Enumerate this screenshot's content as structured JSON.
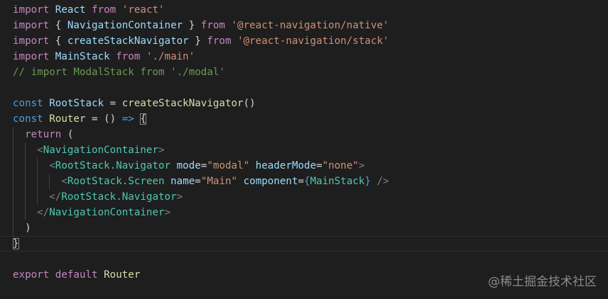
{
  "editor": {
    "lines": [
      {
        "indent": 0,
        "guides": [],
        "tokens": [
          {
            "c": "kw",
            "t": "import"
          },
          {
            "c": "pun",
            "t": " "
          },
          {
            "c": "var",
            "t": "React"
          },
          {
            "c": "pun",
            "t": " "
          },
          {
            "c": "kw",
            "t": "from"
          },
          {
            "c": "pun",
            "t": " "
          },
          {
            "c": "str",
            "t": "'react'"
          }
        ]
      },
      {
        "indent": 0,
        "guides": [],
        "tokens": [
          {
            "c": "kw",
            "t": "import"
          },
          {
            "c": "pun",
            "t": " { "
          },
          {
            "c": "var",
            "t": "NavigationContainer"
          },
          {
            "c": "pun",
            "t": " } "
          },
          {
            "c": "kw",
            "t": "from"
          },
          {
            "c": "pun",
            "t": " "
          },
          {
            "c": "str",
            "t": "'@react-navigation/native'"
          }
        ]
      },
      {
        "indent": 0,
        "guides": [],
        "tokens": [
          {
            "c": "kw",
            "t": "import"
          },
          {
            "c": "pun",
            "t": " { "
          },
          {
            "c": "var",
            "t": "createStackNavigator"
          },
          {
            "c": "pun",
            "t": " } "
          },
          {
            "c": "kw",
            "t": "from"
          },
          {
            "c": "pun",
            "t": " "
          },
          {
            "c": "str",
            "t": "'@react-navigation/stack'"
          }
        ]
      },
      {
        "indent": 0,
        "guides": [],
        "tokens": [
          {
            "c": "kw",
            "t": "import"
          },
          {
            "c": "pun",
            "t": " "
          },
          {
            "c": "var",
            "t": "MainStack"
          },
          {
            "c": "pun",
            "t": " "
          },
          {
            "c": "kw",
            "t": "from"
          },
          {
            "c": "pun",
            "t": " "
          },
          {
            "c": "str",
            "t": "'./main'"
          }
        ]
      },
      {
        "indent": 0,
        "guides": [],
        "tokens": [
          {
            "c": "com",
            "t": "// import ModalStack from './modal'"
          }
        ]
      },
      {
        "indent": 0,
        "guides": [],
        "tokens": []
      },
      {
        "indent": 0,
        "guides": [],
        "tokens": [
          {
            "c": "kw2",
            "t": "const"
          },
          {
            "c": "pun",
            "t": " "
          },
          {
            "c": "var",
            "t": "RootStack"
          },
          {
            "c": "pun",
            "t": " = "
          },
          {
            "c": "fn",
            "t": "createStackNavigator"
          },
          {
            "c": "pun",
            "t": "()"
          }
        ]
      },
      {
        "indent": 0,
        "guides": [],
        "tokens": [
          {
            "c": "kw2",
            "t": "const"
          },
          {
            "c": "pun",
            "t": " "
          },
          {
            "c": "fn",
            "t": "Router"
          },
          {
            "c": "pun",
            "t": " = () "
          },
          {
            "c": "kw2",
            "t": "=>"
          },
          {
            "c": "pun",
            "t": " "
          },
          {
            "c": "bracket-match",
            "t": "{"
          }
        ]
      },
      {
        "indent": 1,
        "guides": [
          0
        ],
        "tokens": [
          {
            "c": "kw",
            "t": "return"
          },
          {
            "c": "pun",
            "t": " ("
          }
        ]
      },
      {
        "indent": 2,
        "guides": [
          0,
          1
        ],
        "tokens": [
          {
            "c": "tag",
            "t": "<"
          },
          {
            "c": "comp",
            "t": "NavigationContainer"
          },
          {
            "c": "tag",
            "t": ">"
          }
        ]
      },
      {
        "indent": 3,
        "guides": [
          0,
          1,
          2
        ],
        "tokens": [
          {
            "c": "tag",
            "t": "<"
          },
          {
            "c": "comp",
            "t": "RootStack.Navigator"
          },
          {
            "c": "pun",
            "t": " "
          },
          {
            "c": "attr",
            "t": "mode"
          },
          {
            "c": "pun",
            "t": "="
          },
          {
            "c": "str",
            "t": "\"modal\""
          },
          {
            "c": "pun",
            "t": " "
          },
          {
            "c": "attr",
            "t": "headerMode"
          },
          {
            "c": "pun",
            "t": "="
          },
          {
            "c": "str",
            "t": "\"none\""
          },
          {
            "c": "tag",
            "t": ">"
          }
        ]
      },
      {
        "indent": 4,
        "guides": [
          0,
          1,
          2,
          3
        ],
        "tokens": [
          {
            "c": "tag",
            "t": "<"
          },
          {
            "c": "comp",
            "t": "RootStack.Screen"
          },
          {
            "c": "pun",
            "t": " "
          },
          {
            "c": "attr",
            "t": "name"
          },
          {
            "c": "pun",
            "t": "="
          },
          {
            "c": "str",
            "t": "\"Main\""
          },
          {
            "c": "pun",
            "t": " "
          },
          {
            "c": "attr",
            "t": "component"
          },
          {
            "c": "pun",
            "t": "="
          },
          {
            "c": "brace",
            "t": "{"
          },
          {
            "c": "comp",
            "t": "MainStack"
          },
          {
            "c": "brace",
            "t": "}"
          },
          {
            "c": "pun",
            "t": " "
          },
          {
            "c": "tag",
            "t": "/>"
          }
        ]
      },
      {
        "indent": 3,
        "guides": [
          0,
          1,
          2
        ],
        "tokens": [
          {
            "c": "tag",
            "t": "</"
          },
          {
            "c": "comp",
            "t": "RootStack.Navigator"
          },
          {
            "c": "tag",
            "t": ">"
          }
        ]
      },
      {
        "indent": 2,
        "guides": [
          0,
          1
        ],
        "tokens": [
          {
            "c": "tag",
            "t": "</"
          },
          {
            "c": "comp",
            "t": "NavigationContainer"
          },
          {
            "c": "tag",
            "t": ">"
          }
        ]
      },
      {
        "indent": 1,
        "guides": [
          0
        ],
        "tokens": [
          {
            "c": "pun",
            "t": ")"
          }
        ]
      },
      {
        "indent": 0,
        "guides": [],
        "current": true,
        "tokens": [
          {
            "c": "bracket-match",
            "t": "}"
          }
        ]
      },
      {
        "indent": 0,
        "guides": [],
        "tokens": []
      },
      {
        "indent": 0,
        "guides": [],
        "tokens": [
          {
            "c": "kw",
            "t": "export"
          },
          {
            "c": "pun",
            "t": " "
          },
          {
            "c": "kw",
            "t": "default"
          },
          {
            "c": "pun",
            "t": " "
          },
          {
            "c": "fn",
            "t": "Router"
          }
        ]
      }
    ]
  },
  "watermark": {
    "text": "@稀土掘金技术社区"
  }
}
